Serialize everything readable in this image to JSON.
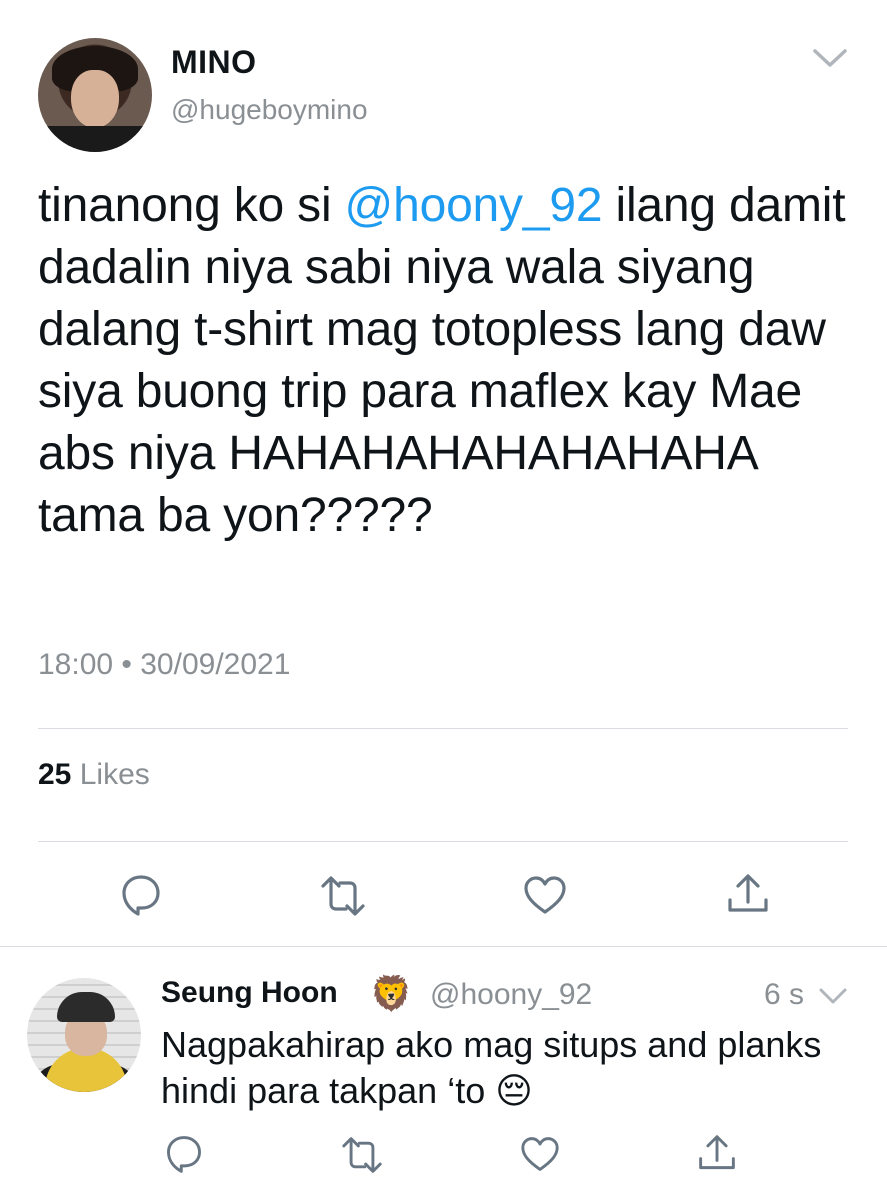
{
  "tweet": {
    "display_name": "MINO",
    "handle": "@hugeboymino",
    "text_before": "tinanong ko si ",
    "mention": "@hoony_92",
    "text_after": " ilang damit dadalin niya sabi niya wala siyang dalang t-shirt mag totopless lang daw siya buong trip para maflex kay Mae abs niya HAHAHAHAHAHAHAHA tama ba yon?????",
    "timestamp": "18:00 • 30/09/2021",
    "likes_count": "25",
    "likes_label": "Likes"
  },
  "reply": {
    "display_name": "Seung Hoon",
    "name_emoji": "🦁",
    "handle": "@hoony_92",
    "time": "6 s",
    "text": "Nagpakahirap ako mag situps and planks hindi para takpan ‘to 😔"
  },
  "icons": {
    "menu": "chevron-down-icon",
    "reply": "comment-icon",
    "retweet": "retweet-icon",
    "like": "heart-icon",
    "share": "share-icon"
  },
  "colors": {
    "mention": "#1d9bf0",
    "secondary_text": "#8a8f94",
    "divider": "#dadde1"
  }
}
